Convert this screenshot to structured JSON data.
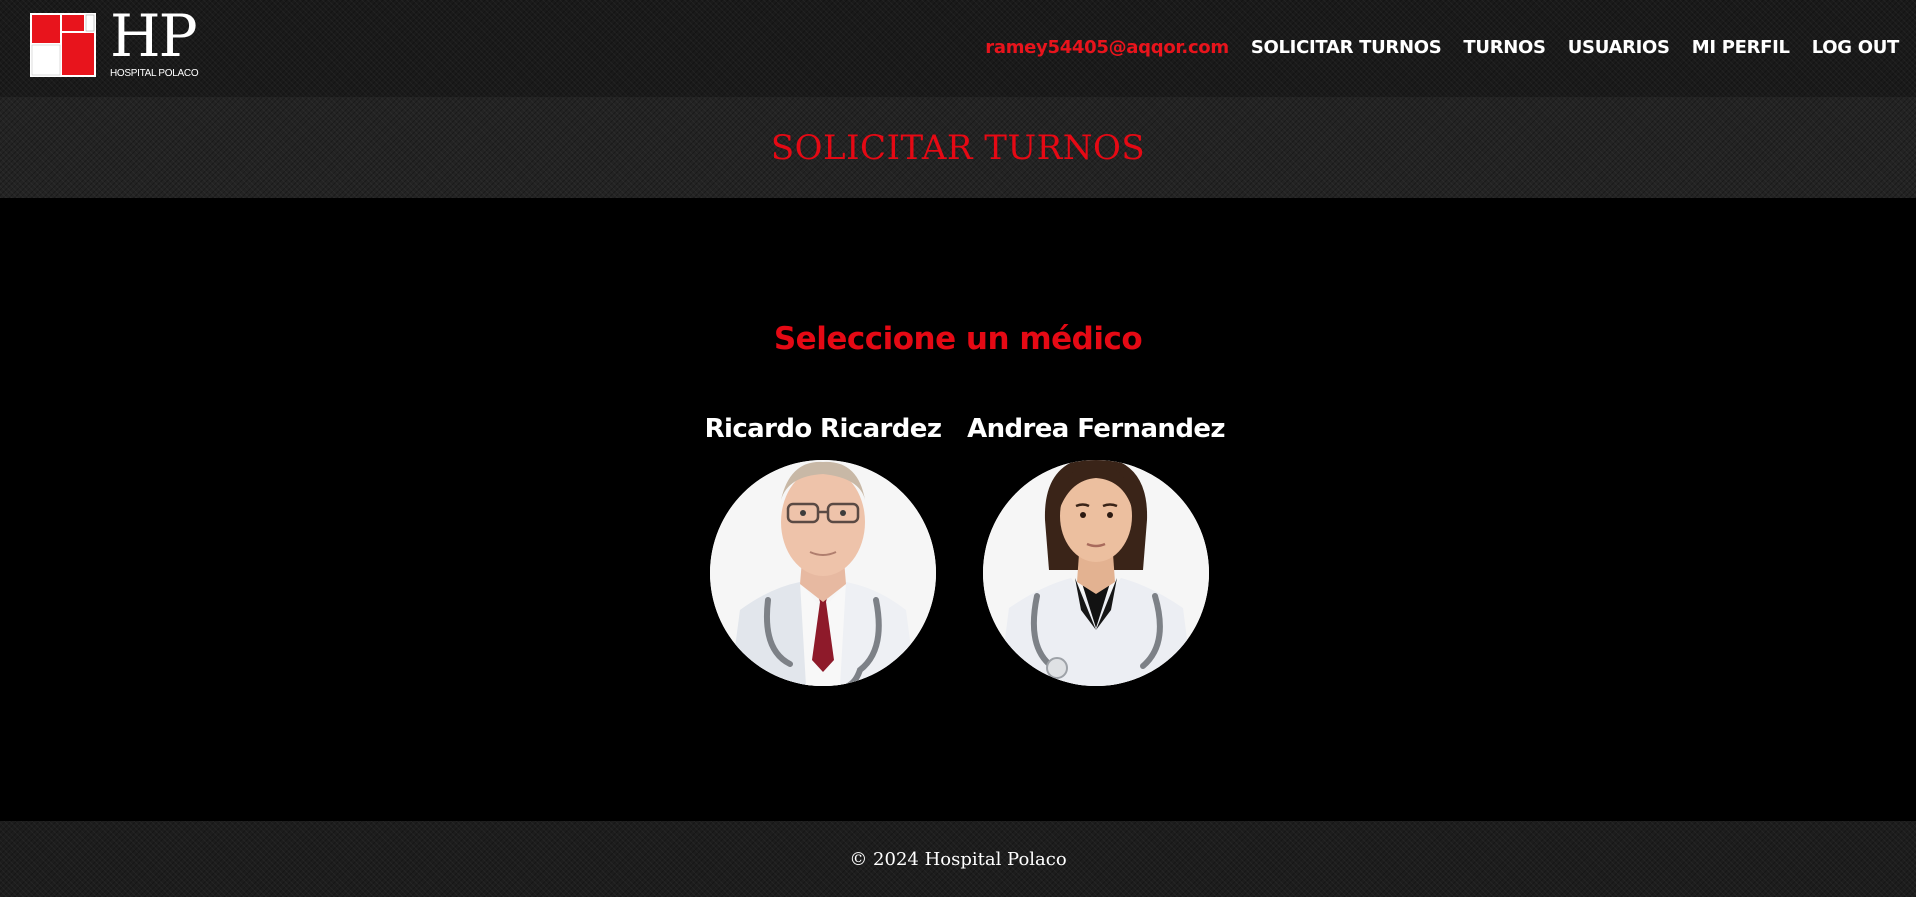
{
  "header": {
    "logo": {
      "letters": "HP",
      "text": "HOSPITAL POLACO",
      "colors": {
        "red": "#e8141c",
        "white": "#ffffff"
      }
    },
    "nav": {
      "user_email": "ramey54405@aqqor.com",
      "solicitar_turnos": "SOLICITAR TURNOS",
      "turnos": "TURNOS",
      "usuarios": "USUARIOS",
      "mi_perfil": "MI PERFIL",
      "logout": "LOG OUT"
    }
  },
  "banner": {
    "title": "SOLICITAR TURNOS"
  },
  "main": {
    "select_title": "Seleccione un médico",
    "doctors": [
      {
        "name": "Ricardo Ricardez",
        "photo_icon": "male-doctor-photo"
      },
      {
        "name": "Andrea Fernandez",
        "photo_icon": "female-doctor-photo"
      }
    ]
  },
  "footer": {
    "copyright": "© 2024 Hospital Polaco"
  },
  "colors": {
    "accent": "#e50914",
    "background": "#000000",
    "bar": "#1b1b1b",
    "text": "#ffffff"
  }
}
